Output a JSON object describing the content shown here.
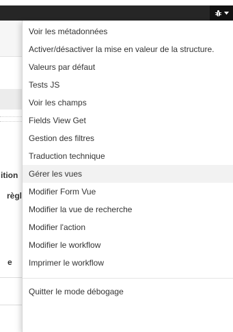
{
  "navbar": {
    "debug_icon": "bug-icon",
    "caret_icon": "caret-down-icon",
    "background_color": "#262626"
  },
  "background_page": {
    "partial_texts": [
      "ition",
      "règl",
      "e"
    ]
  },
  "debug_menu": {
    "items": [
      {
        "label": "Voir les métadonnées"
      },
      {
        "label": "Activer/désactiver la mise en valeur de la structure."
      },
      {
        "label": "Valeurs par défaut"
      },
      {
        "label": "Tests JS"
      },
      {
        "label": "Voir les champs"
      },
      {
        "label": "Fields View Get"
      },
      {
        "label": "Gestion des filtres"
      },
      {
        "label": "Traduction technique"
      },
      {
        "label": "Gérer les vues",
        "highlighted": true
      },
      {
        "label": "Modifier Form Vue"
      },
      {
        "label": "Modifier la vue de recherche"
      },
      {
        "label": "Modifier l'action"
      },
      {
        "label": "Modifier le workflow"
      },
      {
        "label": "Imprimer le workflow"
      }
    ],
    "footer_item": {
      "label": "Quitter le mode débogage"
    }
  }
}
